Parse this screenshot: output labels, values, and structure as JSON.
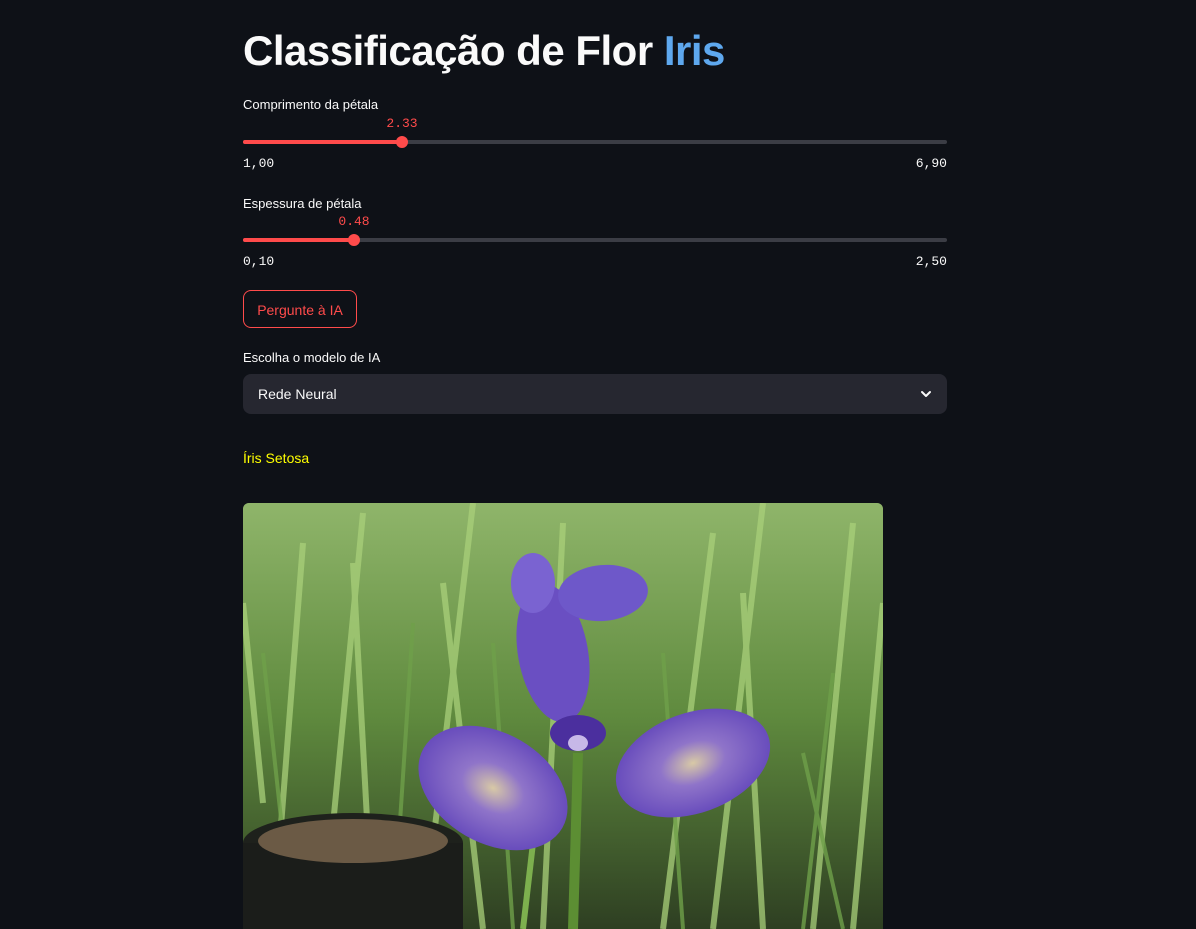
{
  "header": {
    "title_main": "Classificação de Flor ",
    "title_accent": "Iris"
  },
  "sliders": [
    {
      "label": "Comprimento da pétala",
      "value": 2.33,
      "value_text": "2.33",
      "min": 1.0,
      "max": 6.9,
      "min_text": "1,00",
      "max_text": "6,90"
    },
    {
      "label": "Espessura de pétala",
      "value": 0.48,
      "value_text": "0.48",
      "min": 0.1,
      "max": 2.5,
      "min_text": "0,10",
      "max_text": "2,50"
    }
  ],
  "ask_button": {
    "label": "Pergunte à IA"
  },
  "model_select": {
    "label": "Escolha o modelo de IA",
    "selected": "Rede Neural",
    "icon": "chevron-down-icon"
  },
  "result": {
    "text": "Íris Setosa"
  },
  "image": {
    "subject": "iris-flower"
  },
  "colors": {
    "background": "#0e1117",
    "accent_blue": "#5ea8ee",
    "slider_red": "#ff4b4b",
    "result_yellow": "#ffff00",
    "select_bg": "#262730"
  }
}
